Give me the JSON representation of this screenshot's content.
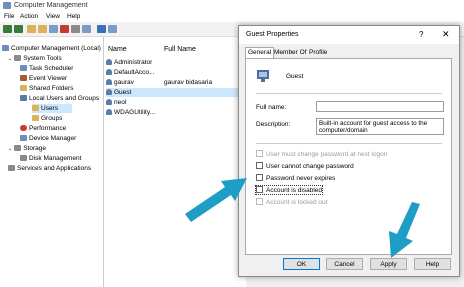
{
  "window": {
    "title": "Computer Management"
  },
  "menu": [
    "File",
    "Action",
    "View",
    "Help"
  ],
  "tree": {
    "root": "Computer Management (Local)",
    "system_tools": "System Tools",
    "task_scheduler": "Task Scheduler",
    "event_viewer": "Event Viewer",
    "shared_folders": "Shared Folders",
    "local_users_groups": "Local Users and Groups",
    "users": "Users",
    "groups": "Groups",
    "performance": "Performance",
    "device_manager": "Device Manager",
    "storage": "Storage",
    "disk_management": "Disk Management",
    "services_apps": "Services and Applications"
  },
  "list": {
    "col_name": "Name",
    "col_fullname": "Full Name",
    "rows": [
      {
        "name": "Administrator",
        "full": ""
      },
      {
        "name": "DefaultAcco...",
        "full": ""
      },
      {
        "name": "gaurav",
        "full": "gaurav bidasaria"
      },
      {
        "name": "Guest",
        "full": ""
      },
      {
        "name": "neol",
        "full": ""
      },
      {
        "name": "WDAGUtility...",
        "full": ""
      }
    ]
  },
  "dialog": {
    "title": "Guest Properties",
    "help": "?",
    "close": "✕",
    "tabs": [
      "General",
      "Member Of",
      "Profile"
    ],
    "username": "Guest",
    "full_name_label": "Full name:",
    "full_name_value": "",
    "description_label": "Description:",
    "description_value": "Built-in account for guest access to the computer/domain",
    "checkboxes": [
      "User must change password at next logon",
      "User cannot change password",
      "Password never expires",
      "Account is disabled",
      "Account is locked out"
    ],
    "buttons": {
      "ok": "OK",
      "cancel": "Cancel",
      "apply": "Apply",
      "help": "Help"
    }
  },
  "colors": {
    "arrow": "#1e9ec5",
    "selection": "#cce8ff",
    "accent": "#0078d7"
  }
}
